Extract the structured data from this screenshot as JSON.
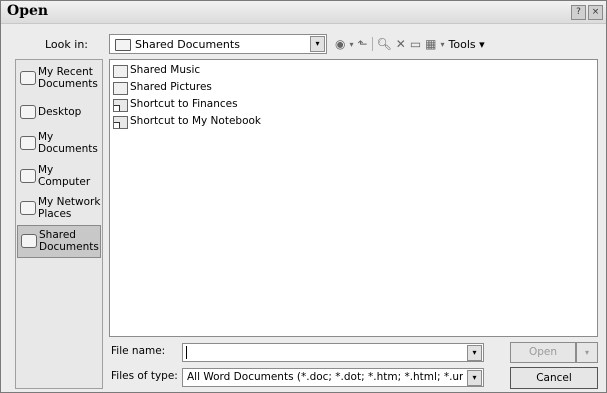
{
  "window": {
    "title": "Open",
    "help_glyph": "?",
    "close_glyph": "×"
  },
  "look_in": {
    "label": "Look in:",
    "value": "Shared Documents"
  },
  "toolbar": {
    "tools_label": "Tools ▾",
    "dropdown_glyph": "▾"
  },
  "places": [
    {
      "label": "My Recent\nDocuments",
      "icon": "recent-docs-icon",
      "selected": false
    },
    {
      "label": "Desktop",
      "icon": "desktop-icon",
      "selected": false
    },
    {
      "label": "My\nDocuments",
      "icon": "my-documents-icon",
      "selected": false
    },
    {
      "label": "My\nComputer",
      "icon": "my-computer-icon",
      "selected": false
    },
    {
      "label": "My Network\nPlaces",
      "icon": "network-places-icon",
      "selected": false
    },
    {
      "label": "Shared\nDocuments",
      "icon": "shared-documents-icon",
      "selected": true
    }
  ],
  "files": [
    {
      "name": "Shared Music",
      "kind": "folder"
    },
    {
      "name": "Shared Pictures",
      "kind": "folder"
    },
    {
      "name": "Shortcut to Finances",
      "kind": "shortcut"
    },
    {
      "name": "Shortcut to My Notebook",
      "kind": "shortcut"
    }
  ],
  "file_name": {
    "label": "File name:",
    "value": ""
  },
  "file_type": {
    "label": "Files of type:",
    "value": "All Word Documents (*.doc; *.dot; *.htm; *.html; *.url; *.rtf; *.mht; *.mhtml; *.xml)"
  },
  "buttons": {
    "open": "Open",
    "cancel": "Cancel"
  }
}
